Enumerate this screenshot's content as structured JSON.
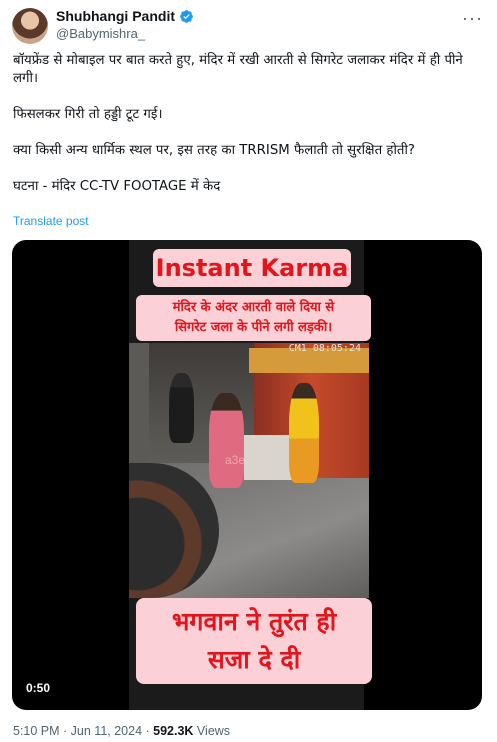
{
  "author": {
    "display_name": "Shubhangi Pandit",
    "handle": "@Babymishra_",
    "verified_icon": "verified-badge-icon",
    "more_icon": "more-options-icon"
  },
  "tweet": {
    "paragraphs": [
      "बॉयफ्रेंड से मोबाइल पर बात करते हुए, मंदिर में रखी आरती से सिगरेट जलाकर मंदिर में ही पीने लगी।",
      "फिसलकर गिरी तो हड्डी टूट गई।",
      "क्या किसी अन्य धार्मिक स्थल पर, इस तरह का TRRISM फैलाती तो सुरक्षित होती?",
      "घटना - मंदिर CC-TV FOOTAGE में केद"
    ],
    "translate_link": "Translate post"
  },
  "video": {
    "caption_title": "Instant Karma",
    "caption_sub_line1": "मंदिर के अंदर आरती वाले दिया से",
    "caption_sub_line2": "सिगरेट जला के पीने लगी लड़की।",
    "caption_bottom_line1": "भगवान ने तुरंत ही",
    "caption_bottom_line2": "सजा दे दी",
    "cctv_timestamp": "CM1 08:05:24",
    "watermark": "a3e",
    "duration": "0:50"
  },
  "footer": {
    "time": "5:10 PM",
    "separator": " · ",
    "date": "Jun 11, 2024",
    "views_count": "592.3K",
    "views_label": " Views"
  },
  "colors": {
    "accent": "#1d9bf0",
    "caption_bg": "#fbd0d6",
    "caption_text": "#e4141a"
  }
}
